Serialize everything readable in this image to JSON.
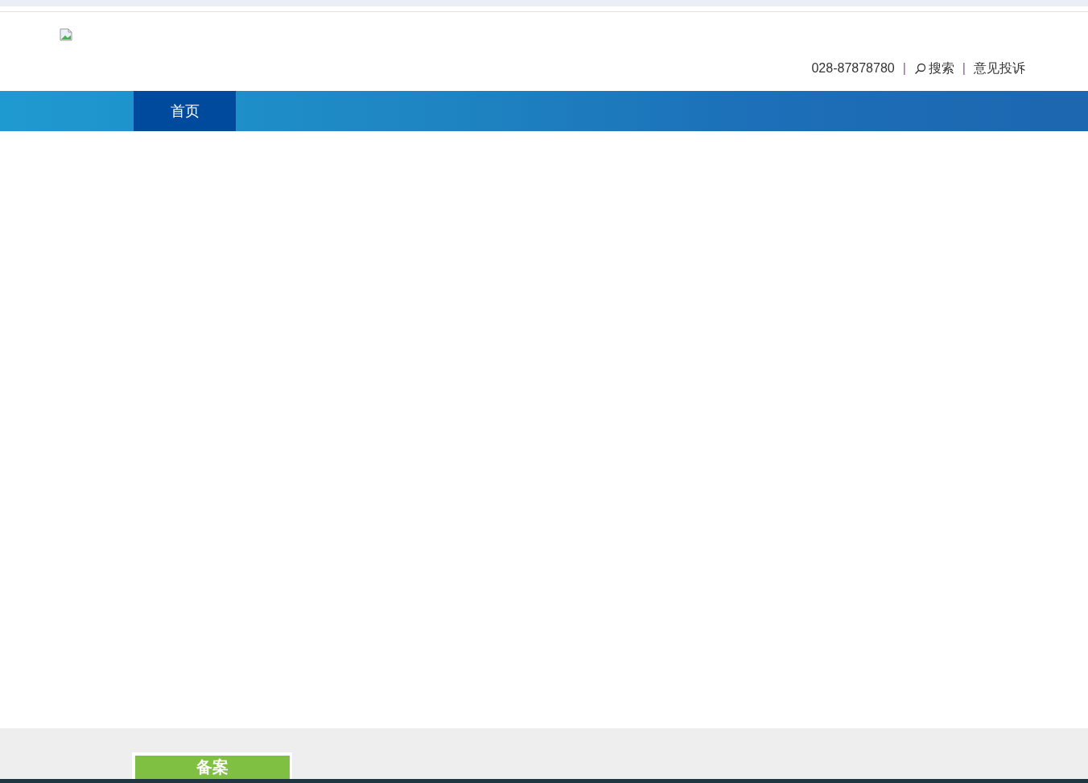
{
  "header_links": [
    {
      "kind": "text",
      "label": "028-87878780"
    },
    {
      "kind": "separator",
      "label": "|"
    },
    {
      "kind": "search",
      "label": "搜索"
    },
    {
      "kind": "separator",
      "label": "|"
    },
    {
      "kind": "link",
      "label": "意见投诉"
    }
  ],
  "nav": [
    {
      "label": "首页",
      "selected": true
    }
  ],
  "footer": {
    "record_button": "备案"
  }
}
